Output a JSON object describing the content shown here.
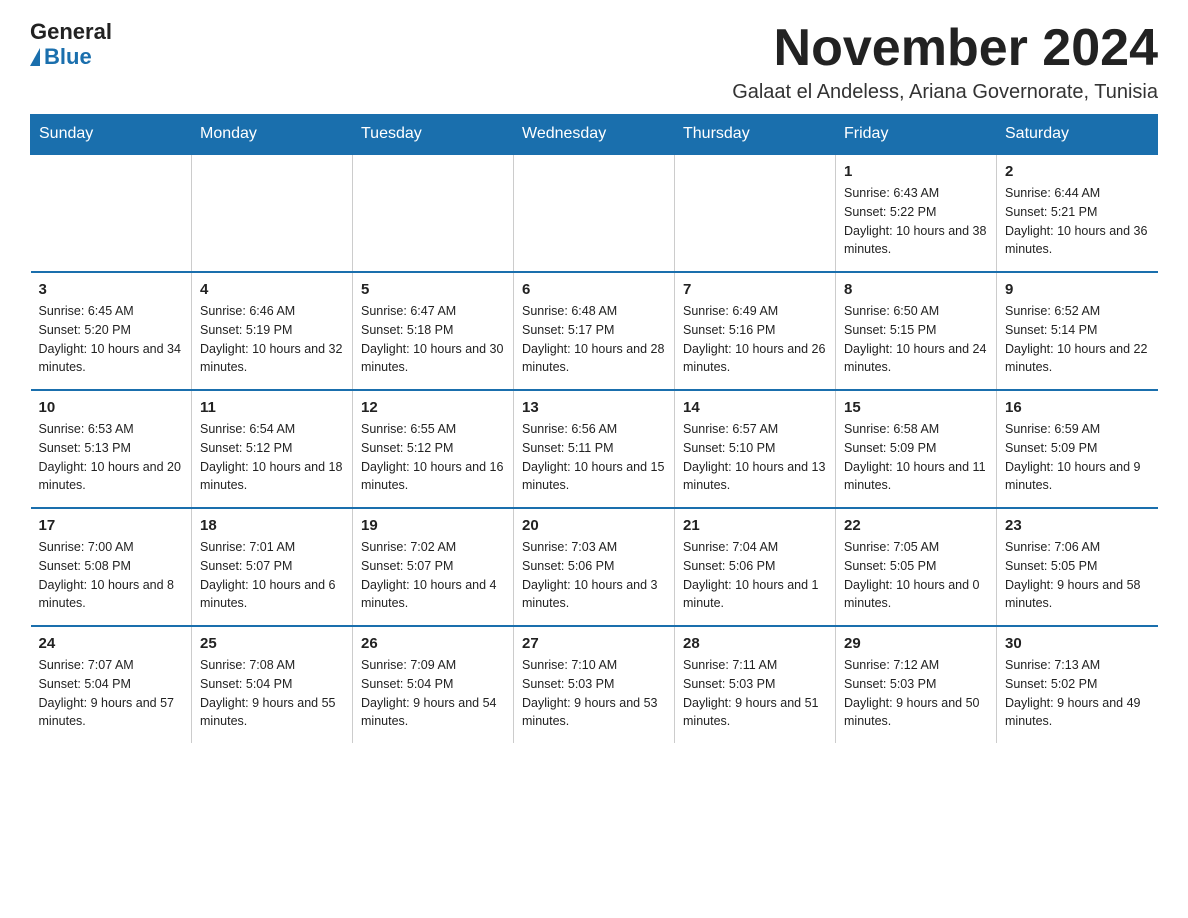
{
  "logo": {
    "general": "General",
    "blue": "Blue"
  },
  "header": {
    "month": "November 2024",
    "location": "Galaat el Andeless, Ariana Governorate, Tunisia"
  },
  "weekdays": [
    "Sunday",
    "Monday",
    "Tuesday",
    "Wednesday",
    "Thursday",
    "Friday",
    "Saturday"
  ],
  "weeks": [
    [
      {
        "day": "",
        "info": ""
      },
      {
        "day": "",
        "info": ""
      },
      {
        "day": "",
        "info": ""
      },
      {
        "day": "",
        "info": ""
      },
      {
        "day": "",
        "info": ""
      },
      {
        "day": "1",
        "info": "Sunrise: 6:43 AM\nSunset: 5:22 PM\nDaylight: 10 hours and 38 minutes."
      },
      {
        "day": "2",
        "info": "Sunrise: 6:44 AM\nSunset: 5:21 PM\nDaylight: 10 hours and 36 minutes."
      }
    ],
    [
      {
        "day": "3",
        "info": "Sunrise: 6:45 AM\nSunset: 5:20 PM\nDaylight: 10 hours and 34 minutes."
      },
      {
        "day": "4",
        "info": "Sunrise: 6:46 AM\nSunset: 5:19 PM\nDaylight: 10 hours and 32 minutes."
      },
      {
        "day": "5",
        "info": "Sunrise: 6:47 AM\nSunset: 5:18 PM\nDaylight: 10 hours and 30 minutes."
      },
      {
        "day": "6",
        "info": "Sunrise: 6:48 AM\nSunset: 5:17 PM\nDaylight: 10 hours and 28 minutes."
      },
      {
        "day": "7",
        "info": "Sunrise: 6:49 AM\nSunset: 5:16 PM\nDaylight: 10 hours and 26 minutes."
      },
      {
        "day": "8",
        "info": "Sunrise: 6:50 AM\nSunset: 5:15 PM\nDaylight: 10 hours and 24 minutes."
      },
      {
        "day": "9",
        "info": "Sunrise: 6:52 AM\nSunset: 5:14 PM\nDaylight: 10 hours and 22 minutes."
      }
    ],
    [
      {
        "day": "10",
        "info": "Sunrise: 6:53 AM\nSunset: 5:13 PM\nDaylight: 10 hours and 20 minutes."
      },
      {
        "day": "11",
        "info": "Sunrise: 6:54 AM\nSunset: 5:12 PM\nDaylight: 10 hours and 18 minutes."
      },
      {
        "day": "12",
        "info": "Sunrise: 6:55 AM\nSunset: 5:12 PM\nDaylight: 10 hours and 16 minutes."
      },
      {
        "day": "13",
        "info": "Sunrise: 6:56 AM\nSunset: 5:11 PM\nDaylight: 10 hours and 15 minutes."
      },
      {
        "day": "14",
        "info": "Sunrise: 6:57 AM\nSunset: 5:10 PM\nDaylight: 10 hours and 13 minutes."
      },
      {
        "day": "15",
        "info": "Sunrise: 6:58 AM\nSunset: 5:09 PM\nDaylight: 10 hours and 11 minutes."
      },
      {
        "day": "16",
        "info": "Sunrise: 6:59 AM\nSunset: 5:09 PM\nDaylight: 10 hours and 9 minutes."
      }
    ],
    [
      {
        "day": "17",
        "info": "Sunrise: 7:00 AM\nSunset: 5:08 PM\nDaylight: 10 hours and 8 minutes."
      },
      {
        "day": "18",
        "info": "Sunrise: 7:01 AM\nSunset: 5:07 PM\nDaylight: 10 hours and 6 minutes."
      },
      {
        "day": "19",
        "info": "Sunrise: 7:02 AM\nSunset: 5:07 PM\nDaylight: 10 hours and 4 minutes."
      },
      {
        "day": "20",
        "info": "Sunrise: 7:03 AM\nSunset: 5:06 PM\nDaylight: 10 hours and 3 minutes."
      },
      {
        "day": "21",
        "info": "Sunrise: 7:04 AM\nSunset: 5:06 PM\nDaylight: 10 hours and 1 minute."
      },
      {
        "day": "22",
        "info": "Sunrise: 7:05 AM\nSunset: 5:05 PM\nDaylight: 10 hours and 0 minutes."
      },
      {
        "day": "23",
        "info": "Sunrise: 7:06 AM\nSunset: 5:05 PM\nDaylight: 9 hours and 58 minutes."
      }
    ],
    [
      {
        "day": "24",
        "info": "Sunrise: 7:07 AM\nSunset: 5:04 PM\nDaylight: 9 hours and 57 minutes."
      },
      {
        "day": "25",
        "info": "Sunrise: 7:08 AM\nSunset: 5:04 PM\nDaylight: 9 hours and 55 minutes."
      },
      {
        "day": "26",
        "info": "Sunrise: 7:09 AM\nSunset: 5:04 PM\nDaylight: 9 hours and 54 minutes."
      },
      {
        "day": "27",
        "info": "Sunrise: 7:10 AM\nSunset: 5:03 PM\nDaylight: 9 hours and 53 minutes."
      },
      {
        "day": "28",
        "info": "Sunrise: 7:11 AM\nSunset: 5:03 PM\nDaylight: 9 hours and 51 minutes."
      },
      {
        "day": "29",
        "info": "Sunrise: 7:12 AM\nSunset: 5:03 PM\nDaylight: 9 hours and 50 minutes."
      },
      {
        "day": "30",
        "info": "Sunrise: 7:13 AM\nSunset: 5:02 PM\nDaylight: 9 hours and 49 minutes."
      }
    ]
  ]
}
